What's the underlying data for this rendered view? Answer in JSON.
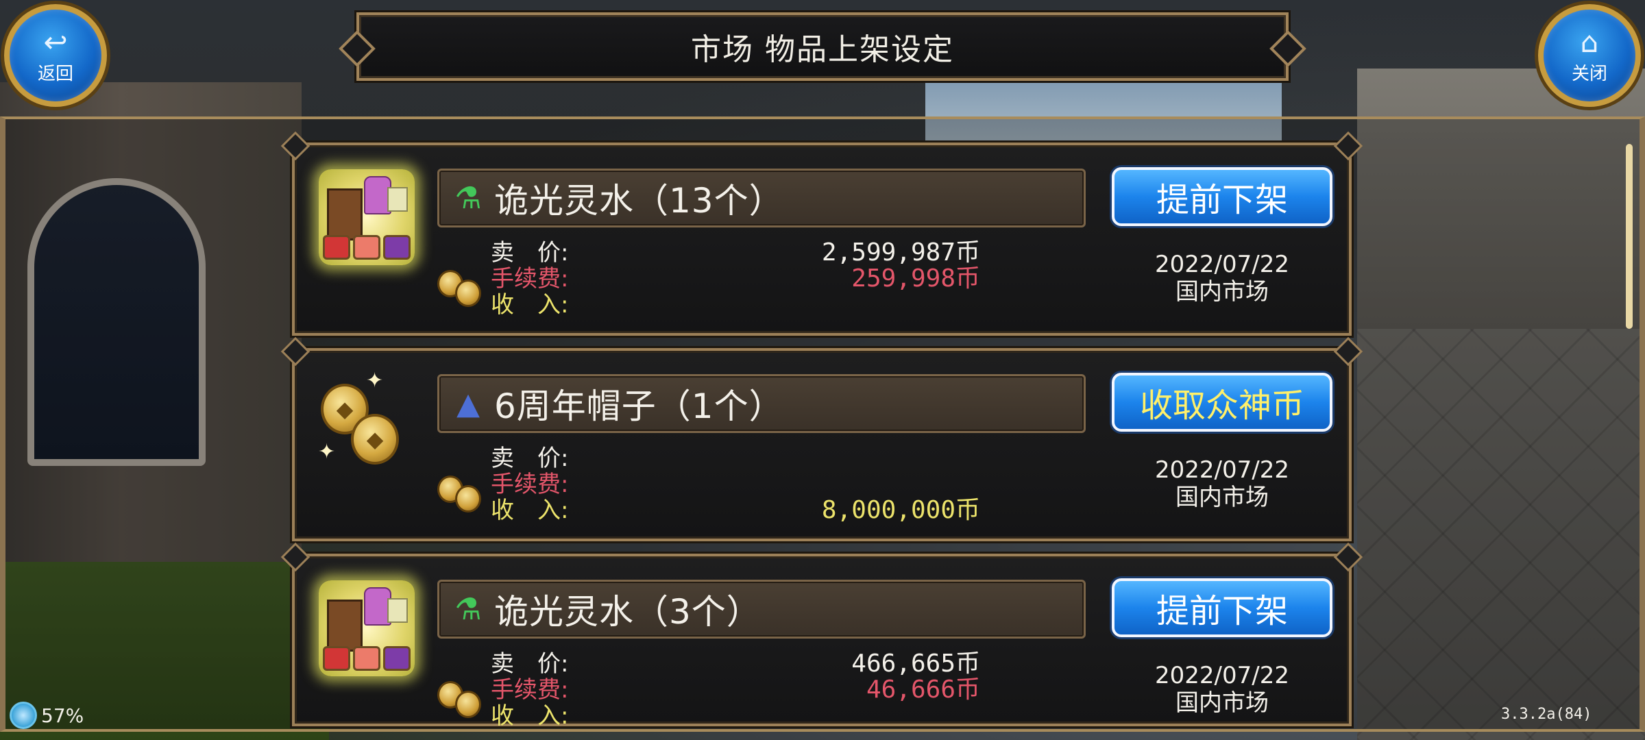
{
  "header": {
    "title": "市场 物品上架设定",
    "back_label": "返回",
    "close_label": "关闭"
  },
  "labels": {
    "price": "卖　价:",
    "fee": "手续费:",
    "income": "收　入:"
  },
  "listings": [
    {
      "name": "诡光灵水（13个）",
      "thumb": "market-stall-icon",
      "name_icon": "potion-icon",
      "price": "2,599,987币",
      "fee": "259,998币",
      "income": "",
      "action": "提前下架",
      "date": "2022/07/22",
      "market": "国内市场"
    },
    {
      "name": "6周年帽子（1个）",
      "thumb": "gold-coins-icon",
      "name_icon": "wizard-hat-icon",
      "price": "",
      "fee": "",
      "income": "8,000,000币",
      "action": "收取众神币",
      "date": "2022/07/22",
      "market": "国内市场"
    },
    {
      "name": "诡光灵水（3个）",
      "thumb": "market-stall-icon",
      "name_icon": "potion-icon",
      "price": "466,665币",
      "fee": "46,666币",
      "income": "",
      "action": "提前下架",
      "date": "2022/07/22",
      "market": "国内市场"
    }
  ],
  "status": {
    "battery": "57%",
    "version": "3.3.2a(84)"
  },
  "colors": {
    "button_blue": "#1c84ec",
    "fee_red": "#e4566a",
    "income_yellow": "#ece36b",
    "frame_gold": "#9c8058"
  }
}
